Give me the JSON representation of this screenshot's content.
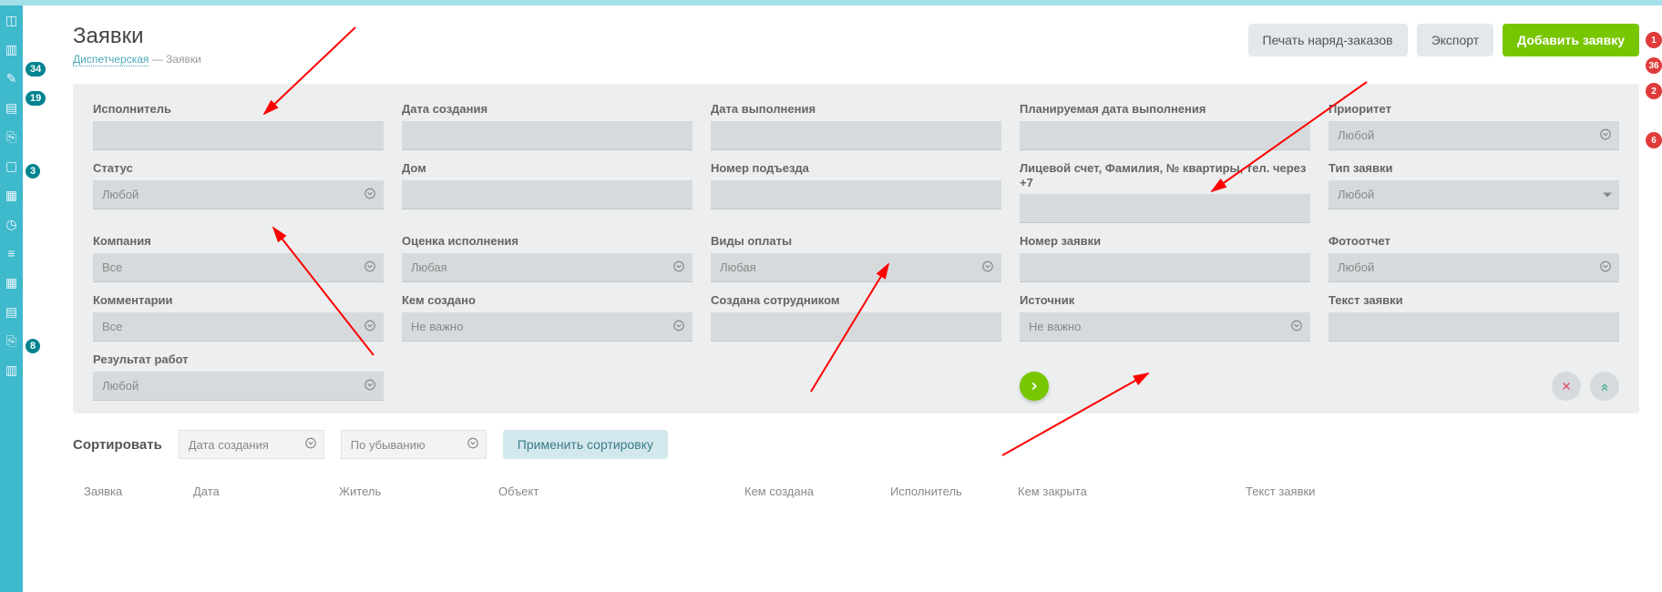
{
  "page": {
    "title": "Заявки",
    "breadcrumb_root": "Диспетчерская",
    "breadcrumb_sep": " — ",
    "breadcrumb_current": "Заявки"
  },
  "header_buttons": {
    "print": "Печать наряд-заказов",
    "export": "Экспорт",
    "add": "Добавить заявку"
  },
  "sidebar_badges": [
    "34",
    "19",
    "3",
    "8"
  ],
  "right_badges": [
    "1",
    "36",
    "2",
    "6"
  ],
  "filters": {
    "executor": {
      "label": "Исполнитель",
      "value": ""
    },
    "date_created": {
      "label": "Дата создания",
      "value": ""
    },
    "date_done": {
      "label": "Дата выполнения",
      "value": ""
    },
    "date_planned": {
      "label": "Планируемая дата выполнения",
      "value": ""
    },
    "priority": {
      "label": "Приоритет",
      "value": "Любой",
      "dropdown": true
    },
    "status": {
      "label": "Статус",
      "value": "Любой",
      "dropdown": true
    },
    "house": {
      "label": "Дом",
      "value": ""
    },
    "entrance": {
      "label": "Номер подъезда",
      "value": ""
    },
    "account": {
      "label": "Лицевой счет, Фамилия, № квартиры, тел. через +7",
      "value": ""
    },
    "type": {
      "label": "Тип заявки",
      "value": "Любой",
      "caret": true
    },
    "company": {
      "label": "Компания",
      "value": "Все",
      "dropdown": true
    },
    "rating": {
      "label": "Оценка исполнения",
      "value": "Любая",
      "dropdown": true
    },
    "pay_type": {
      "label": "Виды оплаты",
      "value": "Любая",
      "dropdown": true
    },
    "req_number": {
      "label": "Номер заявки",
      "value": ""
    },
    "photo": {
      "label": "Фотоотчет",
      "value": "Любой",
      "dropdown": true
    },
    "comments": {
      "label": "Комментарии",
      "value": "Все",
      "dropdown": true
    },
    "created_by": {
      "label": "Кем создано",
      "value": "Не важно",
      "dropdown": true
    },
    "created_staff": {
      "label": "Создана сотрудником",
      "value": ""
    },
    "source": {
      "label": "Источник",
      "value": "Не важно",
      "dropdown": true
    },
    "req_text": {
      "label": "Текст заявки",
      "value": ""
    },
    "work_result": {
      "label": "Результат работ",
      "value": "Любой",
      "dropdown": true
    }
  },
  "sort": {
    "label": "Сортировать",
    "field": "Дата создания",
    "direction": "По убыванию",
    "apply": "Применить сортировку"
  },
  "table": {
    "columns": [
      "Заявка",
      "Дата",
      "Житель",
      "Объект",
      "Кем создана",
      "Исполнитель",
      "Кем закрыта",
      "Текст заявки"
    ]
  }
}
